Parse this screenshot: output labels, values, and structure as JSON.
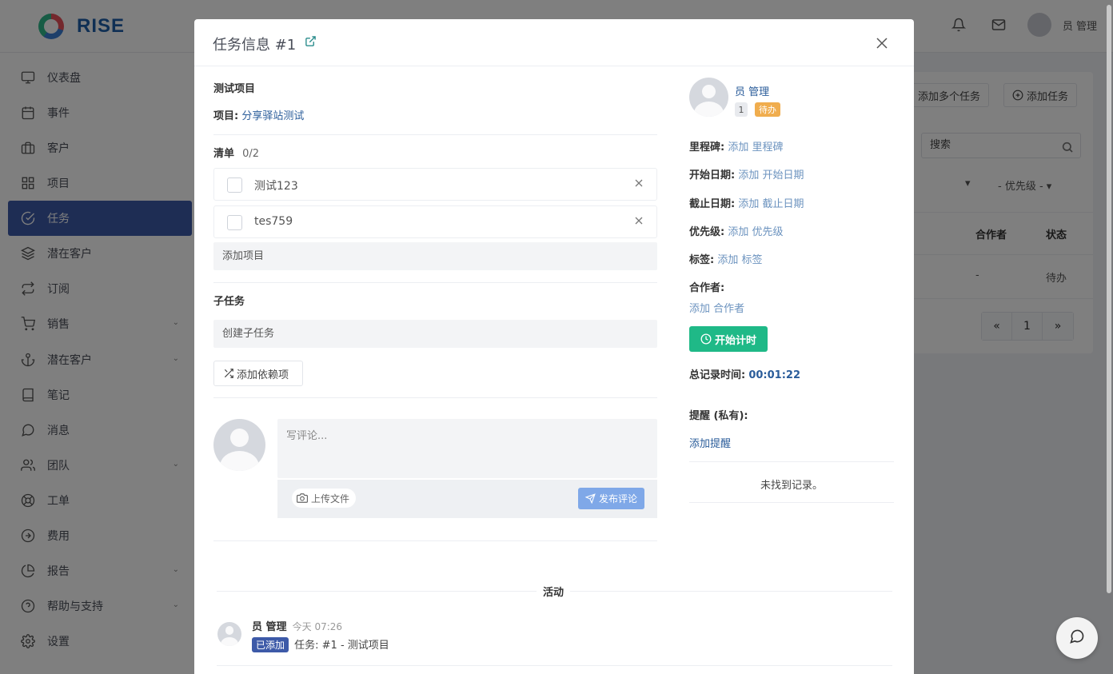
{
  "app": {
    "logo_text": "RISE",
    "user_name": "员 管理"
  },
  "sidebar": {
    "items": [
      {
        "label": "仪表盘",
        "icon": "monitor-icon"
      },
      {
        "label": "事件",
        "icon": "calendar-icon"
      },
      {
        "label": "客户",
        "icon": "briefcase-icon"
      },
      {
        "label": "项目",
        "icon": "grid-icon"
      },
      {
        "label": "任务",
        "icon": "check-circle-icon",
        "active": true
      },
      {
        "label": "潜在客户",
        "icon": "layers-icon"
      },
      {
        "label": "订阅",
        "icon": "repeat-icon"
      },
      {
        "label": "销售",
        "icon": "cart-icon",
        "has_children": true
      },
      {
        "label": "潜在客户",
        "icon": "anchor-icon",
        "has_children": true
      },
      {
        "label": "笔记",
        "icon": "book-icon"
      },
      {
        "label": "消息",
        "icon": "message-icon"
      },
      {
        "label": "团队",
        "icon": "users-icon",
        "has_children": true
      },
      {
        "label": "工单",
        "icon": "lifebuoy-icon"
      },
      {
        "label": "费用",
        "icon": "arrow-circle-icon"
      },
      {
        "label": "报告",
        "icon": "pie-chart-icon",
        "has_children": true
      },
      {
        "label": "帮助与支持",
        "icon": "help-icon",
        "has_children": true
      },
      {
        "label": "设置",
        "icon": "gear-icon"
      }
    ]
  },
  "background_page": {
    "add_multiple_label": "添加多个任务",
    "add_task_label": "添加任务",
    "search_placeholder": "搜索",
    "priority_filter": "- 优先级 -",
    "columns": [
      "合作者",
      "状态"
    ],
    "row": {
      "collaborator": "-",
      "status": "待办"
    },
    "pagination": {
      "prev": "«",
      "page": "1",
      "next": "»"
    }
  },
  "modal": {
    "title": "任务信息 #1",
    "task_title": "测试项目",
    "project_label": "项目:",
    "project_name": "分享驿站测试",
    "checklist": {
      "label": "清单",
      "progress": "0/2",
      "items": [
        {
          "text": "测试123",
          "checked": false
        },
        {
          "text": "tes759",
          "checked": false
        }
      ],
      "add_placeholder": "添加项目"
    },
    "subtasks": {
      "label": "子任务",
      "create_placeholder": "创建子任务"
    },
    "add_dependency_label": "添加依赖项",
    "comment": {
      "placeholder": "写评论...",
      "upload_label": "上传文件",
      "post_label": "发布评论"
    },
    "activity": {
      "label": "活动",
      "entries": [
        {
          "user": "员 管理",
          "time": "今天 07:26",
          "badge": "已添加",
          "text": "任务: #1 - 测试项目"
        }
      ]
    },
    "details": {
      "assignee": "员 管理",
      "number_pill": "1",
      "status": "待办",
      "milestone_label": "里程碑:",
      "milestone_value": "添加 里程碑",
      "start_label": "开始日期:",
      "start_value": "添加 开始日期",
      "deadline_label": "截止日期:",
      "deadline_value": "添加 截止日期",
      "priority_label": "优先级:",
      "priority_value": "添加 优先级",
      "labels_label": "标签:",
      "labels_value": "添加 标签",
      "collaborators_label": "合作者:",
      "collaborators_value": "添加 合作者",
      "timer_label": "开始计时",
      "total_time_label": "总记录时间:",
      "total_time_value": "00:01:22",
      "reminder_label": "提醒 (私有):",
      "add_reminder": "添加提醒",
      "no_records": "未找到记录。"
    }
  },
  "colors": {
    "sidebar_active": "#3d5aa8",
    "timer_button": "#1fb987",
    "status_badge": "#f0ad4e",
    "link": "#2a5c9a",
    "post_button": "#7fa8e8"
  }
}
